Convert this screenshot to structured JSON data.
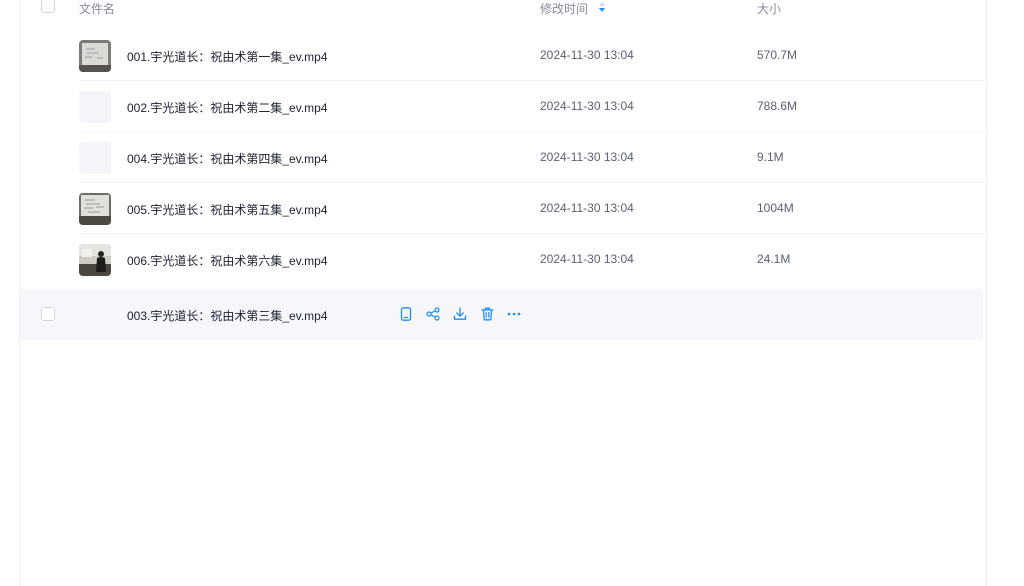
{
  "header": {
    "name_label": "文件名",
    "time_label": "修改时间",
    "size_label": "大小"
  },
  "files": [
    {
      "name": "001.宇光道长：祝由术第一集_ev.mp4",
      "time": "2024-11-30 13:04",
      "size": "570.7M",
      "thumb": "whiteboard-thumbnail"
    },
    {
      "name": "002.宇光道长：祝由术第二集_ev.mp4",
      "time": "2024-11-30 13:04",
      "size": "788.6M",
      "thumb": "blank-thumbnail"
    },
    {
      "name": "004.宇光道长：祝由术第四集_ev.mp4",
      "time": "2024-11-30 13:04",
      "size": "9.1M",
      "thumb": "blank-thumbnail"
    },
    {
      "name": "005.宇光道长：祝由术第五集_ev.mp4",
      "time": "2024-11-30 13:04",
      "size": "1004M",
      "thumb": "whiteboard-thumbnail"
    },
    {
      "name": "006.宇光道长：祝由术第六集_ev.mp4",
      "time": "2024-11-30 13:04",
      "size": "24.1M",
      "thumb": "lecturer-thumbnail"
    }
  ],
  "hover_row": {
    "name": "003.宇光道长：祝由术第三集_ev.mp4",
    "actions": [
      "phone-icon",
      "share-icon",
      "download-icon",
      "delete-icon",
      "more-icon"
    ]
  },
  "colors": {
    "accent": "#1f8cf5",
    "hover_bg": "#f5f7fb",
    "header_text": "#878c9c"
  }
}
